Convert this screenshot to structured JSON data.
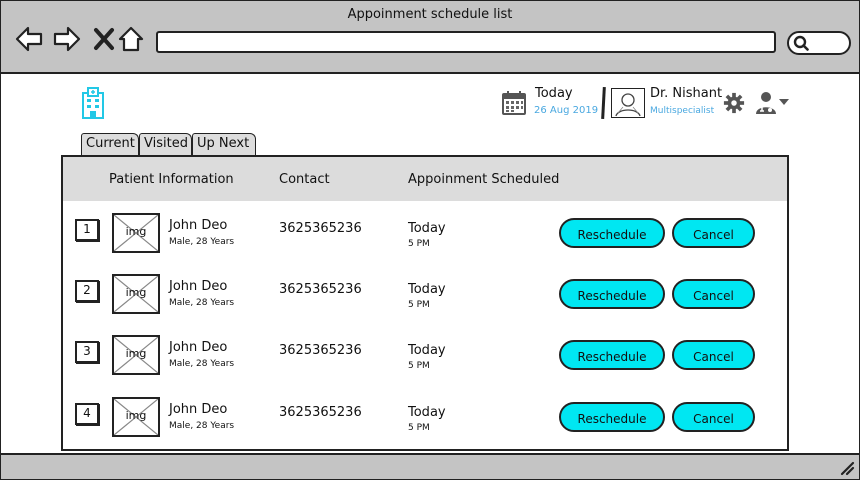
{
  "window": {
    "title": "Appoinment schedule list"
  },
  "header": {
    "today_label": "Today",
    "today_date": "26 Aug 2019",
    "doctor_name": "Dr. Nishant",
    "doctor_specialty": "Multispecialist"
  },
  "tabs": [
    "Current",
    "Visited",
    "Up Next"
  ],
  "columns": [
    "Patient Information",
    "Contact",
    "Appoinment Scheduled"
  ],
  "rows": [
    {
      "num": "1",
      "img": "img",
      "name": "John Deo",
      "info": "Male, 28 Years",
      "contact": "3625365236",
      "day": "Today",
      "time": "5 PM"
    },
    {
      "num": "2",
      "img": "img",
      "name": "John Deo",
      "info": "Male, 28 Years",
      "contact": "3625365236",
      "day": "Today",
      "time": "5 PM"
    },
    {
      "num": "3",
      "img": "img",
      "name": "John Deo",
      "info": "Male, 28 Years",
      "contact": "3625365236",
      "day": "Today",
      "time": "5 PM"
    },
    {
      "num": "4",
      "img": "img",
      "name": "John Deo",
      "info": "Male, 28 Years",
      "contact": "3625365236",
      "day": "Today",
      "time": "5 PM"
    }
  ],
  "buttons": {
    "reschedule": "Reschedule",
    "cancel": "Cancel"
  },
  "icons": {
    "back": "back-arrow-icon",
    "forward": "forward-arrow-icon",
    "stop": "close-icon",
    "home": "home-icon",
    "search": "search-icon",
    "logo": "hospital-icon",
    "calendar": "calendar-icon",
    "settings": "gear-icon",
    "user_menu": "doctor-user-icon"
  },
  "colors": {
    "accent": "#00e7f2",
    "link_blue": "#4aa8e0",
    "chrome": "#c4c4c4",
    "table_header": "#dcdcdc"
  }
}
